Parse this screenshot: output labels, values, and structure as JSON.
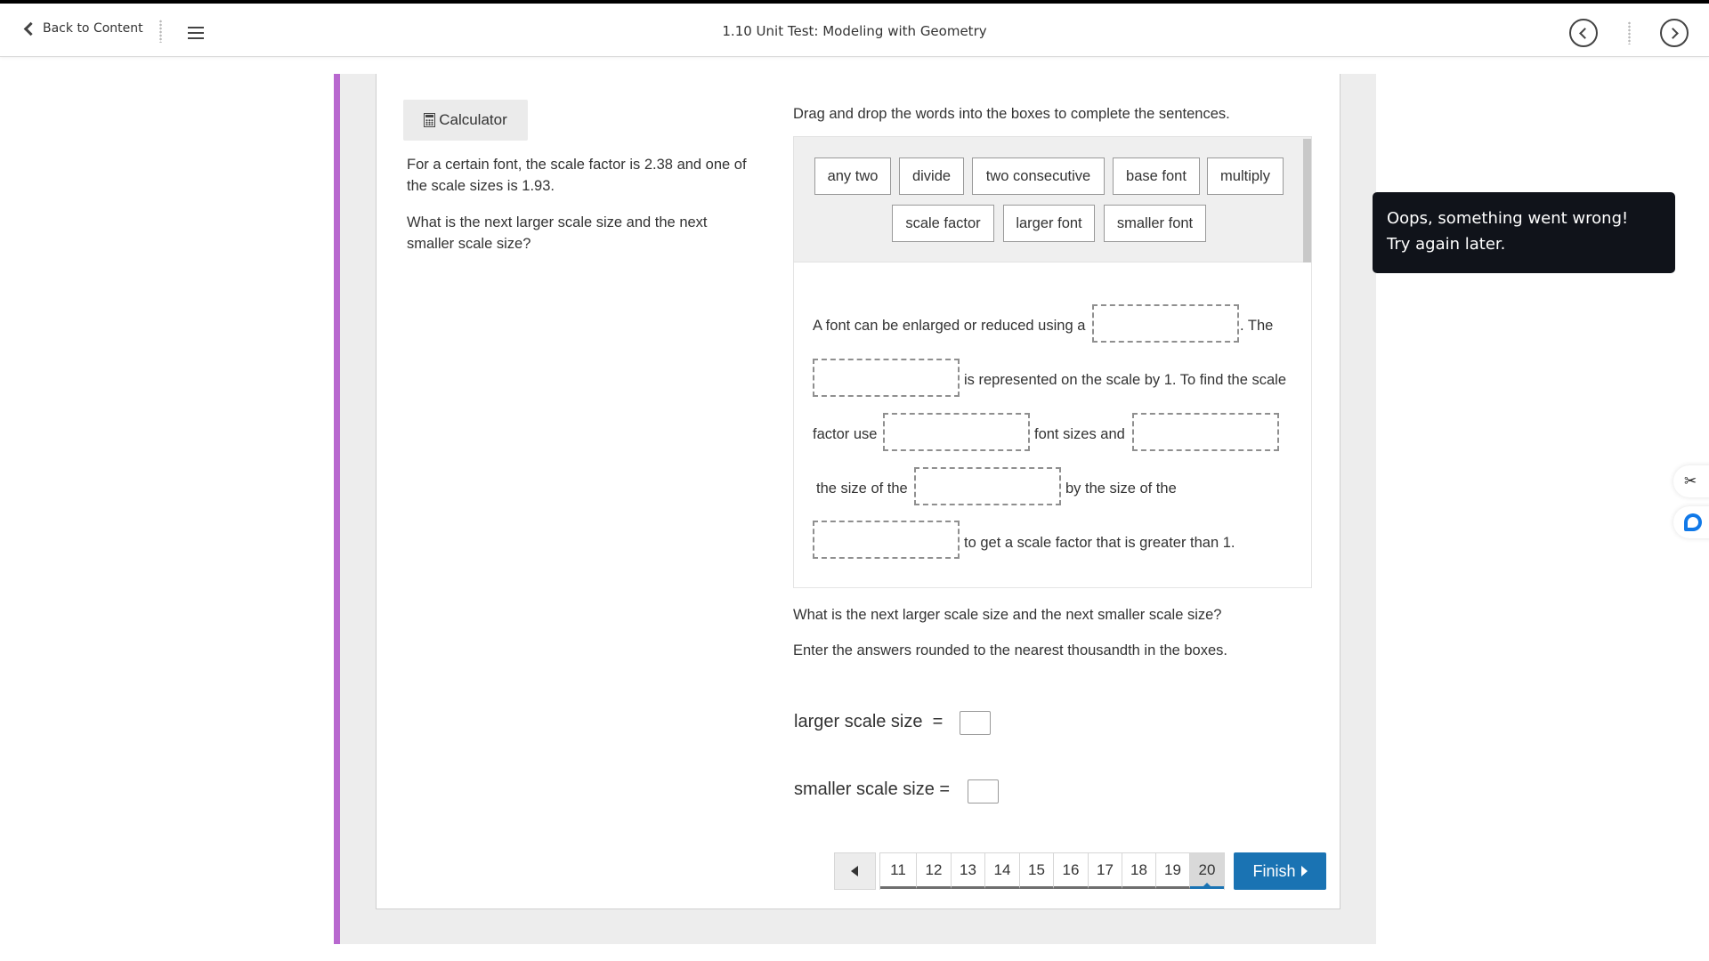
{
  "header": {
    "back_label": "Back to Content",
    "title": "1.10 Unit Test: Modeling with Geometry",
    "icons": {
      "back": "chevron-left-icon",
      "menu": "hamburger-menu-icon",
      "prev": "circle-chevron-left-icon",
      "next": "circle-chevron-right-icon"
    }
  },
  "left": {
    "calculator_label": "Calculator",
    "prompt_1": "For a certain font, the scale factor is 2.38 and one of the scale sizes is 1.93.",
    "prompt_2": "What is the next larger scale size and the next smaller scale size?"
  },
  "drag_drop": {
    "instruction": "Drag and drop the words into the boxes to complete the sentences.",
    "word_bank": [
      "any two",
      "divide",
      "two consecutive",
      "base font",
      "multiply",
      "scale factor",
      "larger font",
      "smaller font"
    ],
    "sentence_parts": {
      "s1": "A font can be enlarged or reduced using a",
      "s2": ". The",
      "s3": "is represented on the scale by 1. To find the scale",
      "s4": "factor use",
      "s5": "font sizes and",
      "s6": "the size of the",
      "s7": "by the size of the",
      "s8": "to get a scale factor that is greater than 1."
    }
  },
  "answers": {
    "question": "What is the next larger scale size and the next smaller scale size?",
    "instruction": "Enter the answers rounded to the nearest thousandth in the boxes.",
    "larger_label": "larger scale size  =",
    "smaller_label": "smaller scale size =",
    "larger_value": "",
    "smaller_value": ""
  },
  "pagination": {
    "pages": [
      "11",
      "12",
      "13",
      "14",
      "15",
      "16",
      "17",
      "18",
      "19",
      "20"
    ],
    "current": "20",
    "finish_label": "Finish"
  },
  "toast": {
    "line1": "Oops, something went wrong!",
    "line2": "Try again later."
  },
  "colors": {
    "accent_purple": "#b868cf",
    "primary_blue": "#1a73b3",
    "toast_bg": "#10131a",
    "chat_blue": "#1179e8"
  }
}
